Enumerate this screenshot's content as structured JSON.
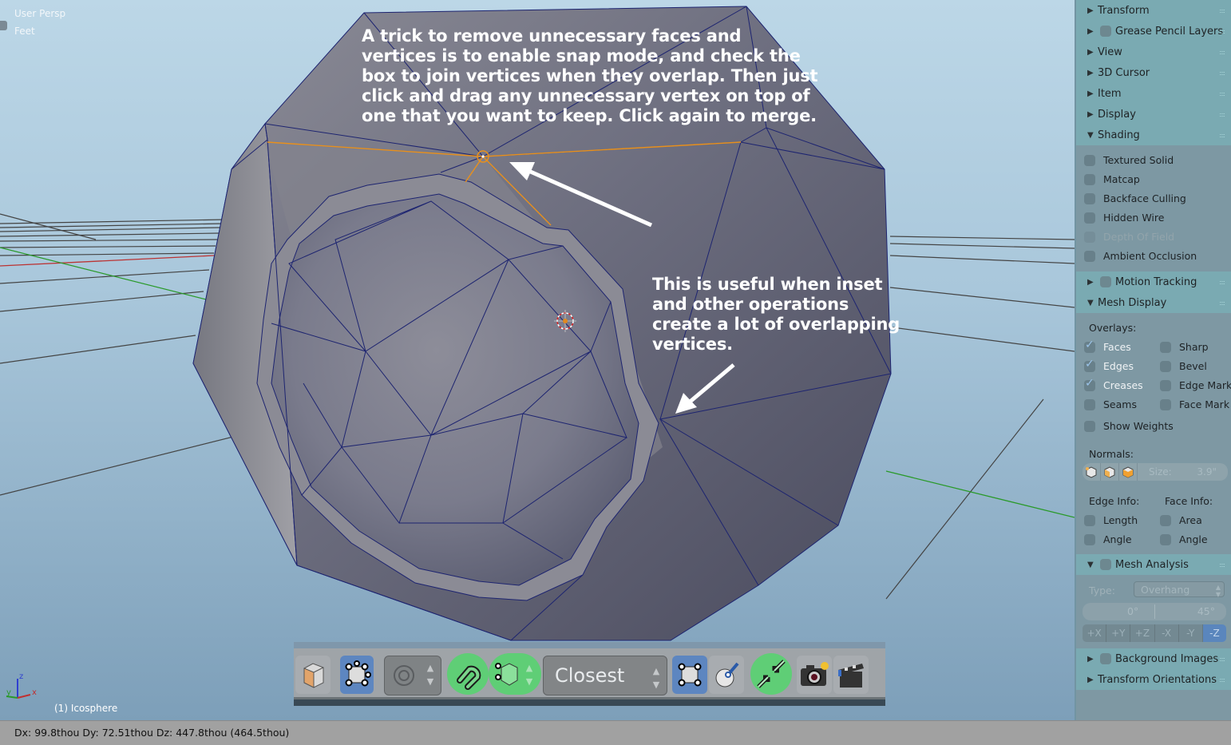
{
  "viewport": {
    "view_name": "User Persp",
    "units": "Feet",
    "object_name": "(1) Icosphere",
    "axis_labels": {
      "x": "x",
      "y": "y",
      "z": "z"
    },
    "colors": {
      "x_axis": "#c03030",
      "y_axis": "#2a9a2a",
      "z_axis": "#2f3fd0",
      "selection": "#e8901c",
      "wire": "#1d2470"
    }
  },
  "annotations": {
    "main": [
      "A trick to remove unnecessary faces and",
      "vertices is to enable snap mode, and check the",
      "box to join vertices when they overlap. Then just",
      "click and drag any  unnecessary vertex on top of",
      "one that you want to keep. Click again to merge."
    ],
    "secondary": [
      "This is useful when inset",
      "and other operations",
      "create a lot of overlapping",
      "vertices."
    ]
  },
  "toolbar": {
    "snap_element_value": "Closest",
    "icons": [
      "solid-shading-icon",
      "vertex-select-icon",
      "proportional-edit-icon",
      "snap-magnet-icon",
      "snap-element-vertex-icon",
      "snap-target-dropdown",
      "snap-align-icon",
      "snap-project-icon",
      "auto-merge-icon",
      "render-still-icon",
      "render-animation-icon"
    ],
    "states": {
      "snap": true,
      "auto_merge": true,
      "snap_element": "Vertex"
    }
  },
  "panel": {
    "sections": [
      {
        "label": "Transform",
        "expanded": false
      },
      {
        "label": "Grease Pencil Layers",
        "expanded": false,
        "checkbox": true
      },
      {
        "label": "View",
        "expanded": false
      },
      {
        "label": "3D Cursor",
        "expanded": false
      },
      {
        "label": "Item",
        "expanded": false
      },
      {
        "label": "Display",
        "expanded": false
      },
      {
        "label": "Shading",
        "expanded": true
      },
      {
        "label": "Motion Tracking",
        "expanded": false,
        "checkbox": true
      },
      {
        "label": "Mesh Display",
        "expanded": true
      },
      {
        "label": "Mesh Analysis",
        "expanded": true,
        "checkbox": true
      },
      {
        "label": "Background Images",
        "expanded": false,
        "checkbox": true
      },
      {
        "label": "Transform Orientations",
        "expanded": false
      }
    ],
    "shading": [
      {
        "label": "Textured Solid",
        "checked": false
      },
      {
        "label": "Matcap",
        "checked": false
      },
      {
        "label": "Backface Culling",
        "checked": false
      },
      {
        "label": "Hidden Wire",
        "checked": false
      },
      {
        "label": "Depth Of Field",
        "checked": false,
        "disabled": true
      },
      {
        "label": "Ambient Occlusion",
        "checked": false
      }
    ],
    "mesh_display": {
      "overlays_label": "Overlays:",
      "overlays_left": [
        {
          "label": "Faces",
          "checked": true
        },
        {
          "label": "Edges",
          "checked": true
        },
        {
          "label": "Creases",
          "checked": true
        },
        {
          "label": "Seams",
          "checked": false
        }
      ],
      "overlays_right": [
        {
          "label": "Sharp",
          "checked": false
        },
        {
          "label": "Bevel",
          "checked": false
        },
        {
          "label": "Edge Mark",
          "checked": false
        },
        {
          "label": "Face Mark",
          "checked": false
        }
      ],
      "show_weights": {
        "label": "Show Weights",
        "checked": false
      },
      "normals_label": "Normals:",
      "normals_size_label": "Size:",
      "normals_size_value": "3.9\"",
      "edge_info_label": "Edge Info:",
      "face_info_label": "Face Info:",
      "edge_info": [
        {
          "label": "Length",
          "checked": false
        },
        {
          "label": "Angle",
          "checked": false
        }
      ],
      "face_info": [
        {
          "label": "Area",
          "checked": false
        },
        {
          "label": "Angle",
          "checked": false
        }
      ]
    },
    "mesh_analysis": {
      "type_label": "Type:",
      "type_value": "Overhang",
      "range_min": "0°",
      "range_max": "45°",
      "axes": [
        {
          "label": "+X",
          "active": false
        },
        {
          "label": "+Y",
          "active": false
        },
        {
          "label": "+Z",
          "active": false
        },
        {
          "label": "-X",
          "active": false
        },
        {
          "label": "-Y",
          "active": false
        },
        {
          "label": "-Z",
          "active": true
        }
      ]
    }
  },
  "status_bar": {
    "text": "Dx: 99.8thou   Dy: 72.51thou   Dz: 447.8thou (464.5thou)"
  }
}
